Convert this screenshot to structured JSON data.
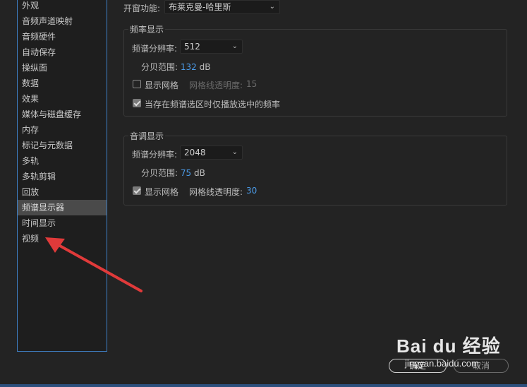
{
  "sidebar": {
    "items": [
      {
        "label": "外观"
      },
      {
        "label": "音频声道映射"
      },
      {
        "label": "音频硬件"
      },
      {
        "label": "自动保存"
      },
      {
        "label": "操纵面"
      },
      {
        "label": "数据"
      },
      {
        "label": "效果"
      },
      {
        "label": "媒体与磁盘缓存"
      },
      {
        "label": "内存"
      },
      {
        "label": "标记与元数据"
      },
      {
        "label": "多轨"
      },
      {
        "label": "多轨剪辑"
      },
      {
        "label": "回放"
      },
      {
        "label": "频谱显示器"
      },
      {
        "label": "时间显示"
      },
      {
        "label": "视频"
      }
    ],
    "selected": "频谱显示器"
  },
  "window_function": {
    "label": "开窗功能:",
    "value": "布莱克曼-哈里斯"
  },
  "frequency": {
    "title": "频率显示",
    "resolution_label": "频谱分辨率:",
    "resolution_value": "512",
    "db_label": "分贝范围:",
    "db_value": "132",
    "db_unit": "dB",
    "show_grid_label": "显示网格",
    "show_grid_checked": false,
    "opacity_label": "网格线透明度:",
    "opacity_value": "15",
    "playback_label": "当存在频谱选区时仅播放选中的频率",
    "playback_checked": true
  },
  "pitch": {
    "title": "音调显示",
    "resolution_label": "频谱分辨率:",
    "resolution_value": "2048",
    "db_label": "分贝范围:",
    "db_value": "75",
    "db_unit": "dB",
    "show_grid_label": "显示网格",
    "show_grid_checked": true,
    "opacity_label": "网格线透明度:",
    "opacity_value": "30"
  },
  "buttons": {
    "ok": "确定",
    "cancel": "取消"
  },
  "watermark": {
    "brand": "Bai du 经验",
    "url": "jingyan.baidu.com"
  },
  "colors": {
    "accent": "#4b9be8",
    "annotation_arrow": "#e03a3a"
  }
}
